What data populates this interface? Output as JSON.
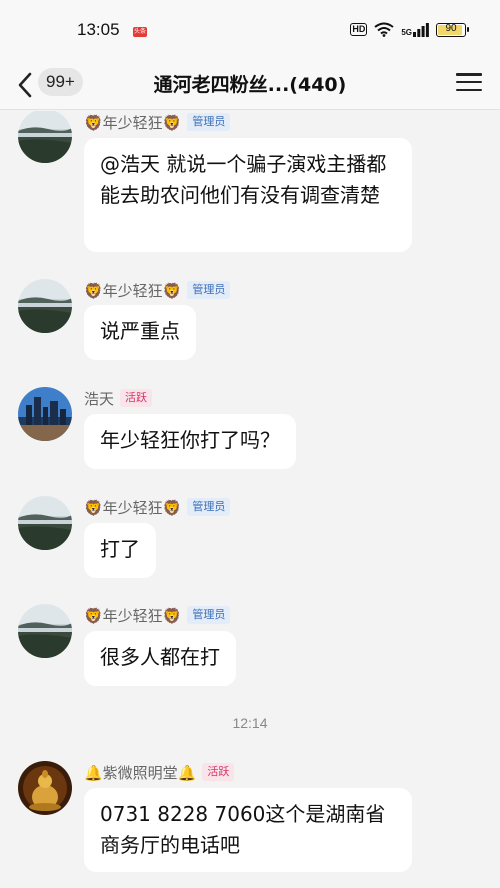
{
  "status_bar": {
    "time": "13:05",
    "news_badge": "头条",
    "hd": "HD",
    "network": "5G",
    "battery": "90"
  },
  "header": {
    "back_icon": "chevron-left-icon",
    "unread_count": "99+",
    "title": "通河老四粉丝...(440)",
    "menu_icon": "hamburger-menu-icon"
  },
  "messages": [
    {
      "sender": "🦁年少轻狂🦁",
      "role": "管理员",
      "text": "@浩天 就说一个骗子演戏主播都能去助农问他们有没有调查清楚"
    },
    {
      "sender": "🦁年少轻狂🦁",
      "role": "管理员",
      "text": "说严重点"
    },
    {
      "sender": "浩天",
      "role": "活跃",
      "text": "年少轻狂你打了吗？"
    },
    {
      "sender": "🦁年少轻狂🦁",
      "role": "管理员",
      "text": "打了"
    },
    {
      "sender": "🦁年少轻狂🦁",
      "role": "管理员",
      "text": "很多人都在打"
    },
    {
      "sender": "🔔紫微照明堂🔔",
      "role": "活跃",
      "text": "0731 8228 7060这个是湖南省商务厅的电话吧"
    }
  ],
  "timestamp": "12:14",
  "colors": {
    "admin_badge_text": "#3e6fb5",
    "active_badge_text": "#d6336c",
    "bubble": "#ffffff",
    "background": "#f3f3f3"
  }
}
